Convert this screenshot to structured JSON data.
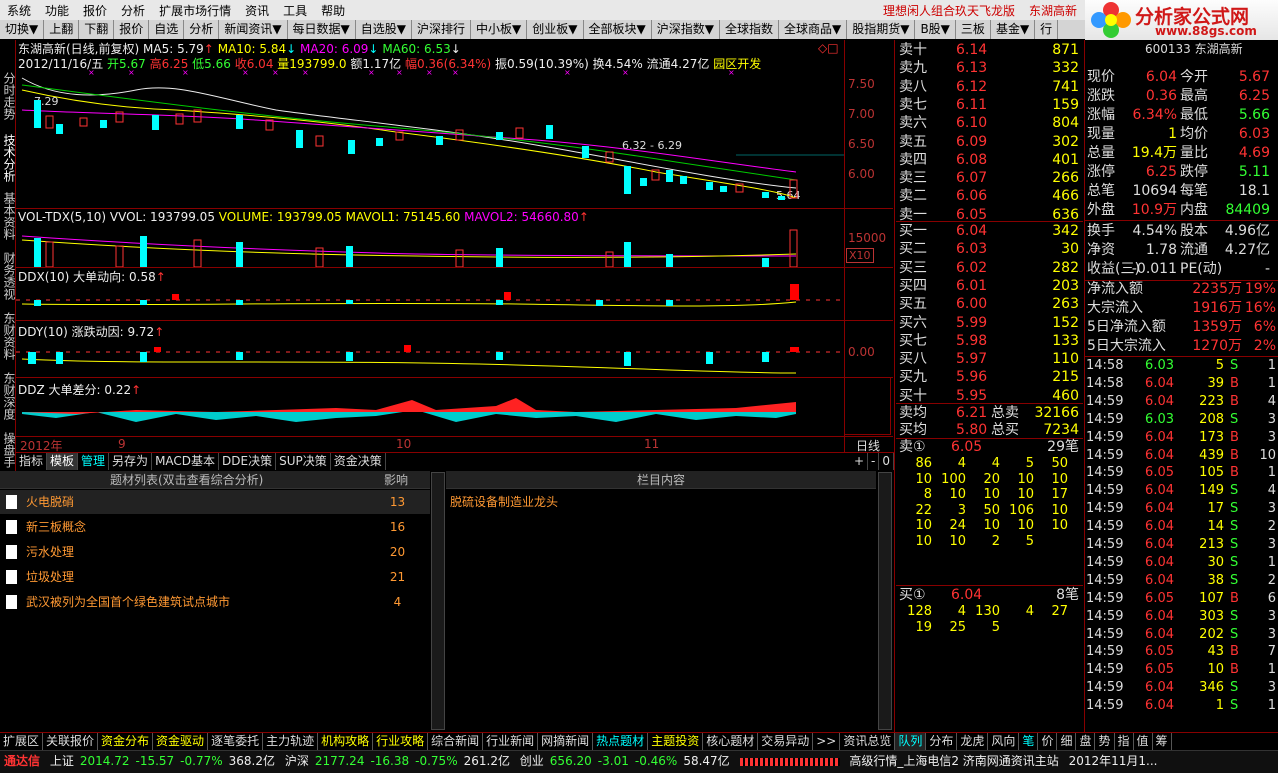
{
  "menubar": {
    "items": [
      "系统",
      "功能",
      "报价",
      "分析",
      "扩展市场行情",
      "资讯",
      "工具",
      "帮助"
    ],
    "promo": "理想闲人组合玖天飞龙版",
    "stock": "东湖高新"
  },
  "logo": {
    "title": "分析家公式网",
    "url": "www.88gs.com"
  },
  "toolbar": {
    "items": [
      "切换▼",
      "上翻",
      "下翻",
      "报价",
      "自选",
      "分析",
      "新闻资讯▼",
      "每日数据▼",
      "自选股▼",
      "沪深排行",
      "中小板▼",
      "创业板▼",
      "全部板块▼",
      "沪深指数▼",
      "全球指数",
      "全球商品▼",
      "股指期货▼",
      "B股▼",
      "三板",
      "基金▼",
      "行"
    ]
  },
  "sidetabs": [
    "分时走势",
    "技术分析",
    "基本资料",
    "财务透视",
    "东财资料",
    "东财深度",
    "操盘手"
  ],
  "chart": {
    "title": "东湖高新(日线,前复权)",
    "ma5": "MA5: 5.79",
    "ma10": "MA10: 5.84",
    "ma20": "MA20: 6.09",
    "ma60": "MA60: 6.53",
    "info_date": "2012/11/16/五",
    "info_open": "开5.67",
    "info_high": "高6.25",
    "info_low": "低5.66",
    "info_close": "收6.04",
    "info_vol": "量193799.0",
    "info_amt": "额1.17亿",
    "info_chg": "幅0.36(6.34%)",
    "info_amp": "振0.59(10.39%)",
    "info_turn": "换4.54%",
    "info_float": "流通4.27亿",
    "info_sector": "园区开发",
    "price_labels": [
      "7.50",
      "7.00",
      "6.50",
      "6.00"
    ],
    "max_label": "7.29",
    "min_label": "5.64",
    "range_label": "6.32 - 6.29",
    "vol_title": "VOL-TDX(5,10)",
    "vol_vvol": "VVOL: 193799.05",
    "vol_volume": "VOLUME: 193799.05",
    "vol_mavol1": "MAVOL1: 75145.60",
    "vol_mavol2": "MAVOL2: 54660.80",
    "vol_scale": "15000",
    "vol_unit": "X10",
    "ddx": "DDX(10) 大单动向: 0.58",
    "ddy": "DDY(10) 涨跌动因: 9.72",
    "ddy_scale": "0.00",
    "ddz": "DDZ 大单差分: 0.22",
    "xaxis": [
      "2012年",
      "9",
      "10",
      "11"
    ],
    "period": "日线"
  },
  "btabs": [
    "指标",
    "模板",
    "管理",
    "另存为",
    "MACD基本",
    "DDE决策",
    "SUP决策",
    "资金决策",
    "+",
    "-",
    "0"
  ],
  "themes": {
    "header_list": "题材列表(双击查看综合分析)",
    "header_impact": "影响",
    "header_col": "栏目内容",
    "content": "脱硫设备制造业龙头",
    "rows": [
      {
        "name": "火电脱硝",
        "impact": "13"
      },
      {
        "name": "新三板概念",
        "impact": "16"
      },
      {
        "name": "污水处理",
        "impact": "20"
      },
      {
        "name": "垃圾处理",
        "impact": "21"
      },
      {
        "name": "武汉被列为全国首个绿色建筑试点城市",
        "impact": "4"
      }
    ]
  },
  "orderbook": {
    "sell": [
      {
        "l": "卖十",
        "p": "6.14",
        "v": "871"
      },
      {
        "l": "卖九",
        "p": "6.13",
        "v": "332"
      },
      {
        "l": "卖八",
        "p": "6.12",
        "v": "741"
      },
      {
        "l": "卖七",
        "p": "6.11",
        "v": "159"
      },
      {
        "l": "卖六",
        "p": "6.10",
        "v": "804"
      },
      {
        "l": "卖五",
        "p": "6.09",
        "v": "302"
      },
      {
        "l": "卖四",
        "p": "6.08",
        "v": "401"
      },
      {
        "l": "卖三",
        "p": "6.07",
        "v": "266"
      },
      {
        "l": "卖二",
        "p": "6.06",
        "v": "466"
      },
      {
        "l": "卖一",
        "p": "6.05",
        "v": "636"
      }
    ],
    "buy": [
      {
        "l": "买一",
        "p": "6.04",
        "v": "342"
      },
      {
        "l": "买二",
        "p": "6.03",
        "v": "30"
      },
      {
        "l": "买三",
        "p": "6.02",
        "v": "282"
      },
      {
        "l": "买四",
        "p": "6.01",
        "v": "203"
      },
      {
        "l": "买五",
        "p": "6.00",
        "v": "263"
      },
      {
        "l": "买六",
        "p": "5.99",
        "v": "152"
      },
      {
        "l": "买七",
        "p": "5.98",
        "v": "133"
      },
      {
        "l": "买八",
        "p": "5.97",
        "v": "110"
      },
      {
        "l": "买九",
        "p": "5.96",
        "v": "215"
      },
      {
        "l": "买十",
        "p": "5.95",
        "v": "460"
      }
    ],
    "avg_sell_label": "卖均",
    "avg_sell": "6.21",
    "total_sell_label": "总卖",
    "total_sell": "32166",
    "avg_buy_label": "买均",
    "avg_buy": "5.80",
    "total_buy_label": "总买",
    "total_buy": "7234",
    "queue_sell_label": "卖①",
    "queue_sell_price": "6.05",
    "queue_sell_count": "29笔",
    "queue_sell": [
      [
        "86",
        "4",
        "4",
        "5",
        "50"
      ],
      [
        "10",
        "100",
        "20",
        "10",
        "10"
      ],
      [
        "8",
        "10",
        "10",
        "10",
        "17"
      ],
      [
        "22",
        "3",
        "50",
        "106",
        "10"
      ],
      [
        "10",
        "24",
        "10",
        "10",
        "10"
      ],
      [
        "10",
        "10",
        "2",
        "5",
        ""
      ]
    ],
    "queue_buy_label": "买①",
    "queue_buy_price": "6.04",
    "queue_buy_count": "8笔",
    "queue_buy": [
      [
        "128",
        "4",
        "130",
        "4",
        "27"
      ],
      [
        "19",
        "25",
        "5",
        "",
        ""
      ]
    ]
  },
  "quote": {
    "code": "600133 东湖高新",
    "rows": [
      [
        {
          "l": "现价",
          "v": "6.04"
        },
        {
          "l": "今开",
          "v": "5.67"
        }
      ],
      [
        {
          "l": "涨跌",
          "v": "0.36"
        },
        {
          "l": "最高",
          "v": "6.25"
        }
      ],
      [
        {
          "l": "涨幅",
          "v": "6.34%"
        },
        {
          "l": "最低",
          "v": "5.66"
        }
      ],
      [
        {
          "l": "现量",
          "v": "1"
        },
        {
          "l": "均价",
          "v": "6.03"
        }
      ],
      [
        {
          "l": "总量",
          "v": "19.4万"
        },
        {
          "l": "量比",
          "v": "4.69"
        }
      ],
      [
        {
          "l": "涨停",
          "v": "6.25"
        },
        {
          "l": "跌停",
          "v": "5.11"
        }
      ],
      [
        {
          "l": "总笔",
          "v": "10694"
        },
        {
          "l": "每笔",
          "v": "18.1"
        }
      ],
      [
        {
          "l": "外盘",
          "v": "10.9万"
        },
        {
          "l": "内盘",
          "v": "84409"
        }
      ],
      [
        {
          "l": "换手",
          "v": "4.54%"
        },
        {
          "l": "股本",
          "v": "4.96亿"
        }
      ],
      [
        {
          "l": "净资",
          "v": "1.78"
        },
        {
          "l": "流通",
          "v": "4.27亿"
        }
      ],
      [
        {
          "l": "收益(三)",
          "v": "-0.011"
        },
        {
          "l": "PE(动)",
          "v": "-"
        }
      ]
    ],
    "flows": [
      {
        "l": "净流入额",
        "v": "2235万",
        "p": "19%"
      },
      {
        "l": "大宗流入",
        "v": "1916万",
        "p": "16%"
      },
      {
        "l": "5日净流入额",
        "v": "1359万",
        "p": "6%"
      },
      {
        "l": "5日大宗流入",
        "v": "1270万",
        "p": "2%"
      }
    ],
    "ticks": [
      [
        "14:58",
        "6.03",
        "5",
        "S",
        "1"
      ],
      [
        "14:58",
        "6.04",
        "39",
        "B",
        "1"
      ],
      [
        "14:59",
        "6.04",
        "223",
        "B",
        "4"
      ],
      [
        "14:59",
        "6.03",
        "208",
        "S",
        "3"
      ],
      [
        "14:59",
        "6.04",
        "173",
        "B",
        "3"
      ],
      [
        "14:59",
        "6.04",
        "439",
        "B",
        "10"
      ],
      [
        "14:59",
        "6.05",
        "105",
        "B",
        "1"
      ],
      [
        "14:59",
        "6.04",
        "149",
        "S",
        "4"
      ],
      [
        "14:59",
        "6.04",
        "17",
        "S",
        "3"
      ],
      [
        "14:59",
        "6.04",
        "14",
        "S",
        "2"
      ],
      [
        "14:59",
        "6.04",
        "213",
        "S",
        "3"
      ],
      [
        "14:59",
        "6.04",
        "30",
        "S",
        "1"
      ],
      [
        "14:59",
        "6.04",
        "38",
        "S",
        "2"
      ],
      [
        "14:59",
        "6.05",
        "107",
        "B",
        "6"
      ],
      [
        "14:59",
        "6.04",
        "303",
        "S",
        "3"
      ],
      [
        "14:59",
        "6.04",
        "202",
        "S",
        "3"
      ],
      [
        "14:59",
        "6.05",
        "43",
        "B",
        "7"
      ],
      [
        "14:59",
        "6.05",
        "10",
        "B",
        "1"
      ],
      [
        "14:59",
        "6.04",
        "346",
        "S",
        "3"
      ],
      [
        "14:59",
        "6.04",
        "1",
        "S",
        "1"
      ]
    ]
  },
  "bottombar": [
    "扩展区",
    "关联报价",
    "资金分布",
    "资金驱动",
    "逐笔委托",
    "主力轨迹",
    "机构攻略",
    "行业攻略",
    "综合新闻",
    "行业新闻",
    "网摘新闻",
    "热点题材",
    "主题投资",
    "核心题材",
    "交易异动",
    ">>",
    "资讯总览",
    "队列",
    "分布",
    "龙虎",
    "风向",
    "笔",
    "价",
    "细",
    "盘",
    "势",
    "指",
    "值",
    "筹"
  ],
  "status": {
    "brand": "通达信",
    "sh_label": "上证",
    "sh": "2014.72",
    "sh_chg": "-15.57",
    "sh_pct": "-0.77%",
    "sh_amt": "368.2亿",
    "sz_label": "沪深",
    "sz": "2177.24",
    "sz_chg": "-16.38",
    "sz_pct": "-0.75%",
    "sz_amt": "261.2亿",
    "cy_label": "创业",
    "cy": "656.20",
    "cy_chg": "-3.01",
    "cy_pct": "-0.46%",
    "cy_amt": "58.47亿",
    "server": "高级行情_上海电信2 济南网通资讯主站",
    "date": "2012年11月1..."
  }
}
